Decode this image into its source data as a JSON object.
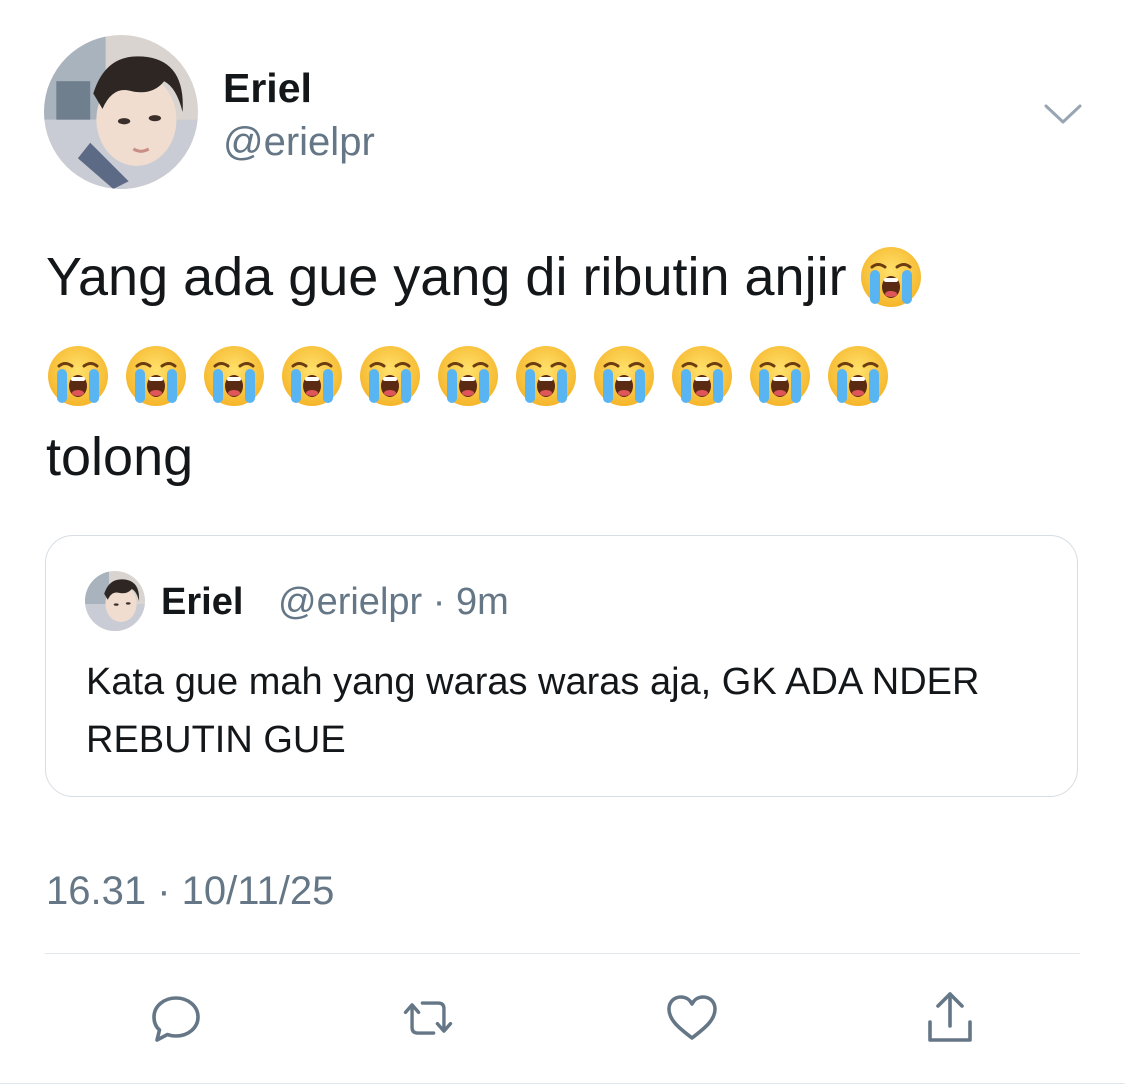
{
  "author": {
    "display_name": "Eriel",
    "handle": "@erielpr"
  },
  "tweet": {
    "text_line_1": "Yang ada gue yang di ributin anjir",
    "emoji_name": "loudly-crying-face",
    "emoji_row_count": 11,
    "text_line_3": "tolong"
  },
  "quoted_tweet": {
    "display_name": "Eriel",
    "handle_and_time": "@erielpr · 9m",
    "text": "Kata gue mah yang waras waras aja, GK ADA NDER REBUTIN GUE"
  },
  "timestamp": "16.31 · 10/11/25",
  "actions": {
    "reply_icon": "reply-icon",
    "retweet_icon": "retweet-icon",
    "like_icon": "heart-icon",
    "share_icon": "share-icon"
  },
  "colors": {
    "text_primary": "#14171a",
    "text_secondary": "#657786",
    "border": "#d7dde3",
    "icon": "#657786"
  }
}
